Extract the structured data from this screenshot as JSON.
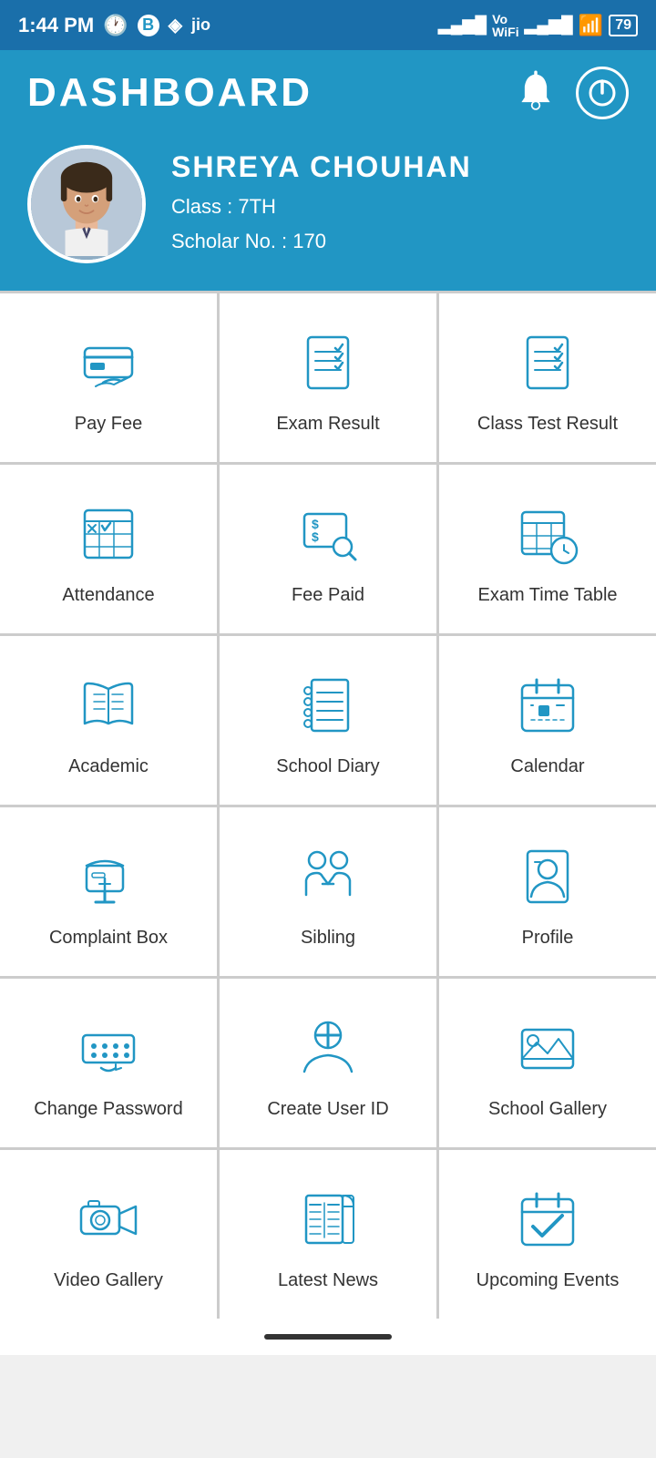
{
  "statusBar": {
    "time": "1:44 PM",
    "battery": "79"
  },
  "header": {
    "title": "DASHBOARD",
    "bellLabel": "notifications",
    "powerLabel": "power"
  },
  "profile": {
    "name": "SHREYA  CHOUHAN",
    "classLabel": "Class : 7TH",
    "scholarLabel": "Scholar No. : 170"
  },
  "gridItems": [
    {
      "id": "pay-fee",
      "label": "Pay Fee",
      "icon": "pay-fee-icon"
    },
    {
      "id": "exam-result",
      "label": "Exam Result",
      "icon": "exam-result-icon"
    },
    {
      "id": "class-test-result",
      "label": "Class Test Result",
      "icon": "class-test-icon"
    },
    {
      "id": "attendance",
      "label": "Attendance",
      "icon": "attendance-icon"
    },
    {
      "id": "fee-paid",
      "label": "Fee Paid",
      "icon": "fee-paid-icon"
    },
    {
      "id": "exam-time-table",
      "label": "Exam Time Table",
      "icon": "exam-timetable-icon"
    },
    {
      "id": "academic",
      "label": "Academic",
      "icon": "academic-icon"
    },
    {
      "id": "school-diary",
      "label": "School Diary",
      "icon": "school-diary-icon"
    },
    {
      "id": "calendar",
      "label": "Calendar",
      "icon": "calendar-icon"
    },
    {
      "id": "complaint-box",
      "label": "Complaint Box",
      "icon": "complaint-icon"
    },
    {
      "id": "sibling",
      "label": "Sibling",
      "icon": "sibling-icon"
    },
    {
      "id": "profile",
      "label": "Profile",
      "icon": "profile-icon"
    },
    {
      "id": "change-password",
      "label": "Change Password",
      "icon": "change-password-icon"
    },
    {
      "id": "create-user-id",
      "label": "Create User ID",
      "icon": "create-user-icon"
    },
    {
      "id": "school-gallery",
      "label": "School Gallery",
      "icon": "school-gallery-icon"
    },
    {
      "id": "video-gallery",
      "label": "Video Gallery",
      "icon": "video-gallery-icon"
    },
    {
      "id": "latest-news",
      "label": "Latest News",
      "icon": "latest-news-icon"
    },
    {
      "id": "upcoming-events",
      "label": "Upcoming Events",
      "icon": "upcoming-events-icon"
    }
  ],
  "accentColor": "#2196c4"
}
